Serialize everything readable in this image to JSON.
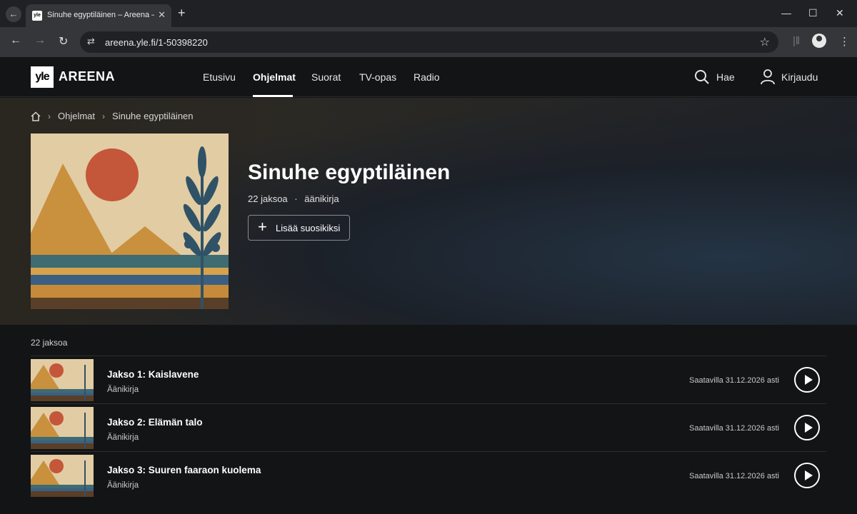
{
  "browser": {
    "tab_title": "Sinuhe egyptiläinen – Areena – Yle",
    "favicon_text": "yle",
    "url": "areena.yle.fi/1-50398220"
  },
  "header": {
    "logo_box": "yle",
    "logo_text": "AREENA",
    "nav": [
      "Etusivu",
      "Ohjelmat",
      "Suorat",
      "TV-opas",
      "Radio"
    ],
    "search_label": "Hae",
    "login_label": "Kirjaudu"
  },
  "breadcrumb": [
    "Ohjelmat",
    "Sinuhe egyptiläinen"
  ],
  "series": {
    "title": "Sinuhe egyptiläinen",
    "episode_count": "22 jaksoa",
    "separator": "·",
    "type": "äänikirja",
    "favorite_label": "Lisää suosikiksi"
  },
  "episodes_heading": "22 jaksoa",
  "episodes": [
    {
      "title": "Jakso 1: Kaislavene",
      "subtitle": "Äänikirja",
      "availability": "Saatavilla 31.12.2026 asti"
    },
    {
      "title": "Jakso 2: Elämän talo",
      "subtitle": "Äänikirja",
      "availability": "Saatavilla 31.12.2026 asti"
    },
    {
      "title": "Jakso 3: Suuren faaraon kuolema",
      "subtitle": "Äänikirja",
      "availability": "Saatavilla 31.12.2026 asti"
    }
  ],
  "colors": {
    "background": "#131415",
    "cover_sun": "#c4563a",
    "cover_stripe": "#3f6b73",
    "cover_sand": "#c9903e"
  }
}
